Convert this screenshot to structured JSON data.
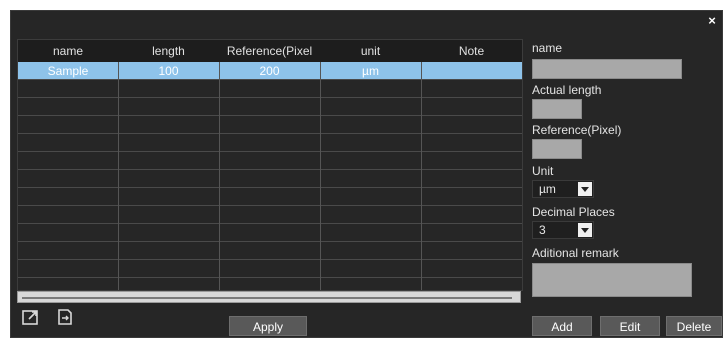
{
  "window": {
    "close_glyph": "×"
  },
  "table": {
    "columns": [
      "name",
      "length",
      "Reference(Pixel",
      "unit",
      "Note"
    ],
    "rows": [
      [
        "Sample",
        "100",
        "200",
        "µm",
        ""
      ]
    ]
  },
  "panel": {
    "name_label": "name",
    "name_value": "",
    "actual_length_label": "Actual length",
    "actual_length_value": "",
    "reference_label": "Reference(Pixel)",
    "reference_value": "",
    "unit_label": "Unit",
    "unit_value": "µm",
    "decimal_label": "Decimal Places",
    "decimal_value": "3",
    "remark_label": "Aditional remark",
    "remark_value": ""
  },
  "buttons": {
    "apply": "Apply",
    "add": "Add",
    "edit": "Edit",
    "delete": "Delete"
  },
  "icons": {
    "import": "import-icon",
    "export": "export-icon"
  },
  "colors": {
    "background": "#262626",
    "selected_row": "#8ec3ea",
    "input_fill": "#a8a8a8",
    "button_fill": "#595959"
  }
}
